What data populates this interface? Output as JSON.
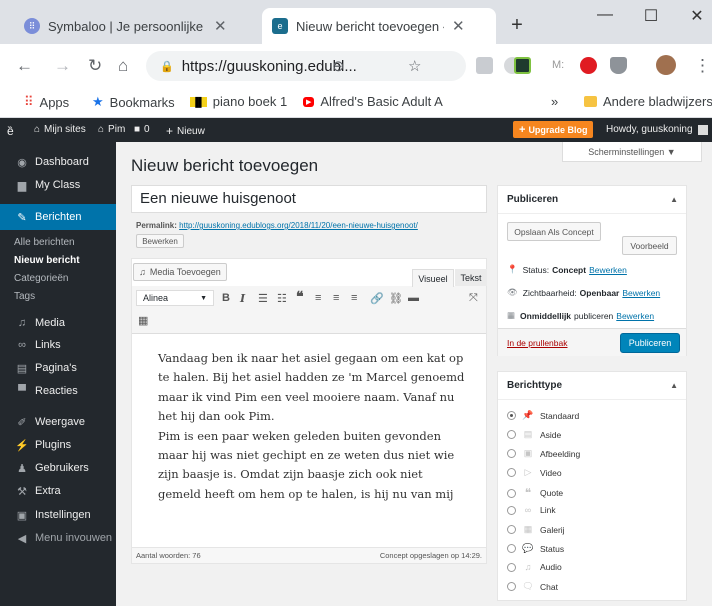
{
  "browser": {
    "tabs": [
      {
        "title": "Symbaloo | Je persoonlijke Starti"
      },
      {
        "title": "Nieuw bericht toevoegen ‹ Pim"
      }
    ],
    "url": "https://guuskoning.edubl...",
    "bookmarks": [
      "Apps",
      "Bookmarks",
      "piano boek 1",
      "Alfred's Basic Adult A"
    ],
    "other_bookmarks": "Andere bladwijzers",
    "more": "»"
  },
  "adminbar": {
    "sites": "Mijn sites",
    "site": "Pim",
    "comments": "0",
    "new": "Nieuw",
    "upgrade": "Upgrade Blog",
    "howdy": "Howdy, guuskoning"
  },
  "sidebar": {
    "items": [
      {
        "label": "Dashboard",
        "icon": "dashboard-icon"
      },
      {
        "label": "My Class",
        "icon": "class-icon"
      },
      {
        "label": "Berichten",
        "icon": "pin-icon"
      },
      {
        "label": "Media",
        "icon": "media-icon"
      },
      {
        "label": "Links",
        "icon": "link-icon"
      },
      {
        "label": "Pagina's",
        "icon": "page-icon"
      },
      {
        "label": "Reacties",
        "icon": "comment-icon"
      },
      {
        "label": "Weergave",
        "icon": "brush-icon"
      },
      {
        "label": "Plugins",
        "icon": "plugin-icon"
      },
      {
        "label": "Gebruikers",
        "icon": "user-icon"
      },
      {
        "label": "Extra",
        "icon": "wrench-icon"
      },
      {
        "label": "Instellingen",
        "icon": "settings-icon"
      },
      {
        "label": "Menu invouwen",
        "icon": "collapse-icon"
      }
    ],
    "submenu": [
      "Alle berichten",
      "Nieuw bericht",
      "Categorieën",
      "Tags"
    ]
  },
  "main": {
    "heading": "Nieuw bericht toevoegen",
    "screen_options": "Scherminstellingen ▼",
    "title_value": "Een nieuwe huisgenoot",
    "permalink_label": "Permalink:",
    "permalink_url": "http://guuskoning.edublogs.org/2018/11/20/een-nieuwe-huisgenoot/",
    "edit_permalink": "Bewerken",
    "add_media": "Media Toevoegen",
    "tab_visual": "Visueel",
    "tab_text": "Tekst",
    "format_select": "Alinea",
    "content_p1": "Vandaag ben ik naar het asiel gegaan om een kat op te halen. Bij het asiel hadden ze 'm Marcel genoemd maar ik vind Pim een veel mooiere naam. Vanaf nu het hij dan ook Pim.",
    "content_p2": "Pim is een paar weken geleden buiten gevonden maar hij was niet gechipt en ze weten dus niet wie zijn baasje is. Omdat zijn baasje zich ook niet gemeld heeft om hem op te halen, is hij nu van mij",
    "word_count": "Aantal woorden: 76",
    "draft_saved": "Concept opgeslagen op 14:29."
  },
  "publish": {
    "title": "Publiceren",
    "save_draft": "Opslaan Als Concept",
    "preview": "Voorbeeld",
    "status_label": "Status:",
    "status_value": "Concept",
    "visibility_label": "Zichtbaarheid:",
    "visibility_value": "Openbaar",
    "schedule_label": "Onmiddellijk",
    "schedule_rest": "publiceren",
    "edit": "Bewerken",
    "trash": "In de prullenbak",
    "publish_btn": "Publiceren"
  },
  "format": {
    "title": "Berichttype",
    "options": [
      "Standaard",
      "Aside",
      "Afbeelding",
      "Video",
      "Quote",
      "Link",
      "Galerij",
      "Status",
      "Audio",
      "Chat"
    ],
    "selected": "Standaard"
  },
  "colors": {
    "wp_blue": "#0073aa",
    "admin_dark": "#23282d",
    "upgrade_orange": "#f6861f"
  }
}
